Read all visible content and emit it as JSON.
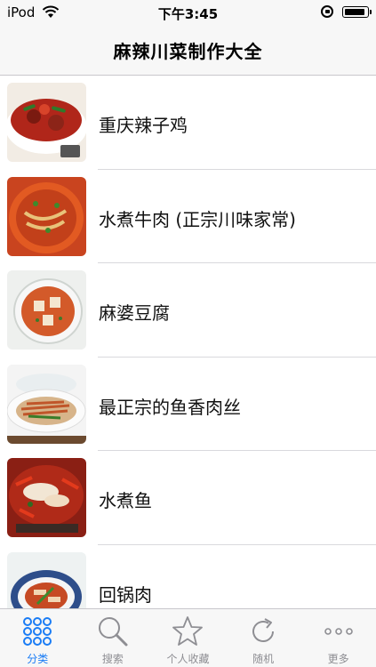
{
  "status_bar": {
    "carrier": "iPod",
    "time": "下午3:45"
  },
  "nav": {
    "title": "麻辣川菜制作大全"
  },
  "recipes": [
    {
      "name": "重庆辣子鸡"
    },
    {
      "name": "水煮牛肉 (正宗川味家常)"
    },
    {
      "name": "麻婆豆腐"
    },
    {
      "name": "最正宗的鱼香肉丝"
    },
    {
      "name": "水煮鱼"
    },
    {
      "name": "回锅肉"
    }
  ],
  "tabs": [
    {
      "label": "分类",
      "icon": "grid-dots-icon",
      "active": true
    },
    {
      "label": "搜索",
      "icon": "magnifier-icon",
      "active": false
    },
    {
      "label": "个人收藏",
      "icon": "star-icon",
      "active": false
    },
    {
      "label": "随机",
      "icon": "refresh-icon",
      "active": false
    },
    {
      "label": "更多",
      "icon": "more-dots-icon",
      "active": false
    }
  ],
  "colors": {
    "accent": "#1a7cf5",
    "inactive": "#8e8e93",
    "bar_background": "#f7f7f7"
  }
}
